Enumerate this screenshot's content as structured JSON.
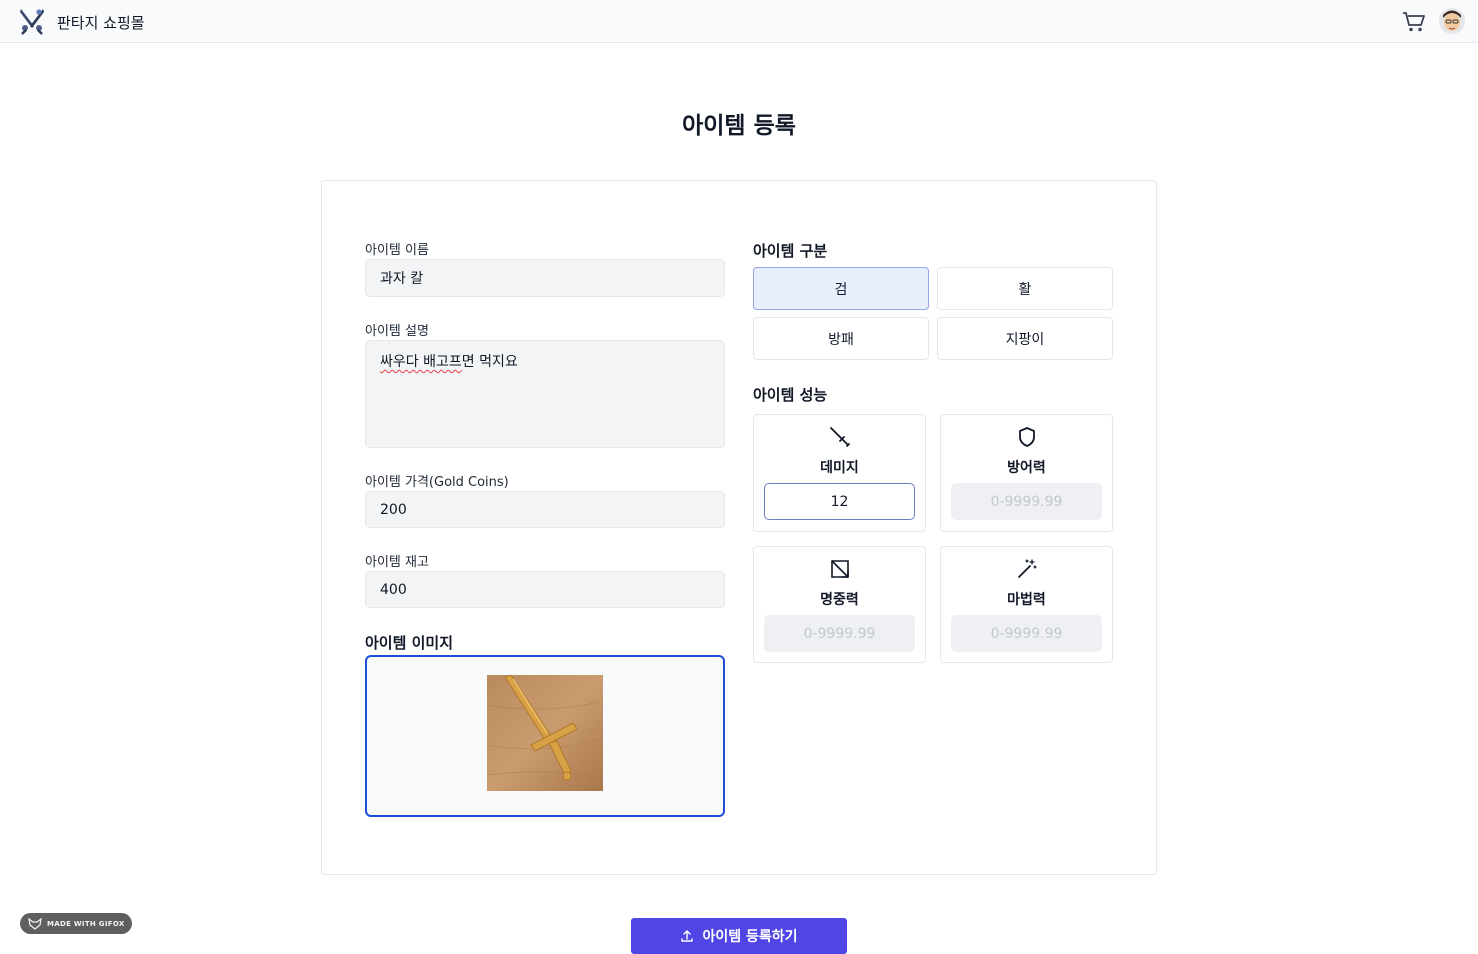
{
  "header": {
    "brand": "판타지 쇼핑몰",
    "icons": [
      "crossed-swords-logo-icon",
      "cart-icon",
      "avatar"
    ]
  },
  "page_title": "아이템 등록",
  "form": {
    "name": {
      "label": "아이템 이름",
      "value": "과자 칼"
    },
    "description": {
      "label": "아이템 설명",
      "value_misspelled": "싸우다 배고프",
      "value_rest": "면 먹지요"
    },
    "price": {
      "label": "아이템 가격(Gold Coins)",
      "value": "200"
    },
    "stock": {
      "label": "아이템 재고",
      "value": "400"
    },
    "image": {
      "label": "아이템 이미지"
    }
  },
  "item_type": {
    "label": "아이템 구분",
    "options": [
      "검",
      "활",
      "방패",
      "지팡이"
    ],
    "selected": "검"
  },
  "stats": {
    "label": "아이템 성능",
    "items": [
      {
        "label": "데미지",
        "value": "12",
        "placeholder": "",
        "icon": "sword-icon"
      },
      {
        "label": "방어력",
        "value": "",
        "placeholder": "0-9999.99",
        "icon": "shield-icon"
      },
      {
        "label": "명중력",
        "value": "",
        "placeholder": "0-9999.99",
        "icon": "target-arrow-icon"
      },
      {
        "label": "마법력",
        "value": "",
        "placeholder": "0-9999.99",
        "icon": "magic-wand-icon"
      }
    ]
  },
  "submit_label": "아이템 등록하기",
  "badge_text": "MADE WITH GIFOX",
  "colors": {
    "accent": "#4f46e5",
    "selected_bg": "#e8eefc",
    "focus_border": "#1d4ed8"
  }
}
